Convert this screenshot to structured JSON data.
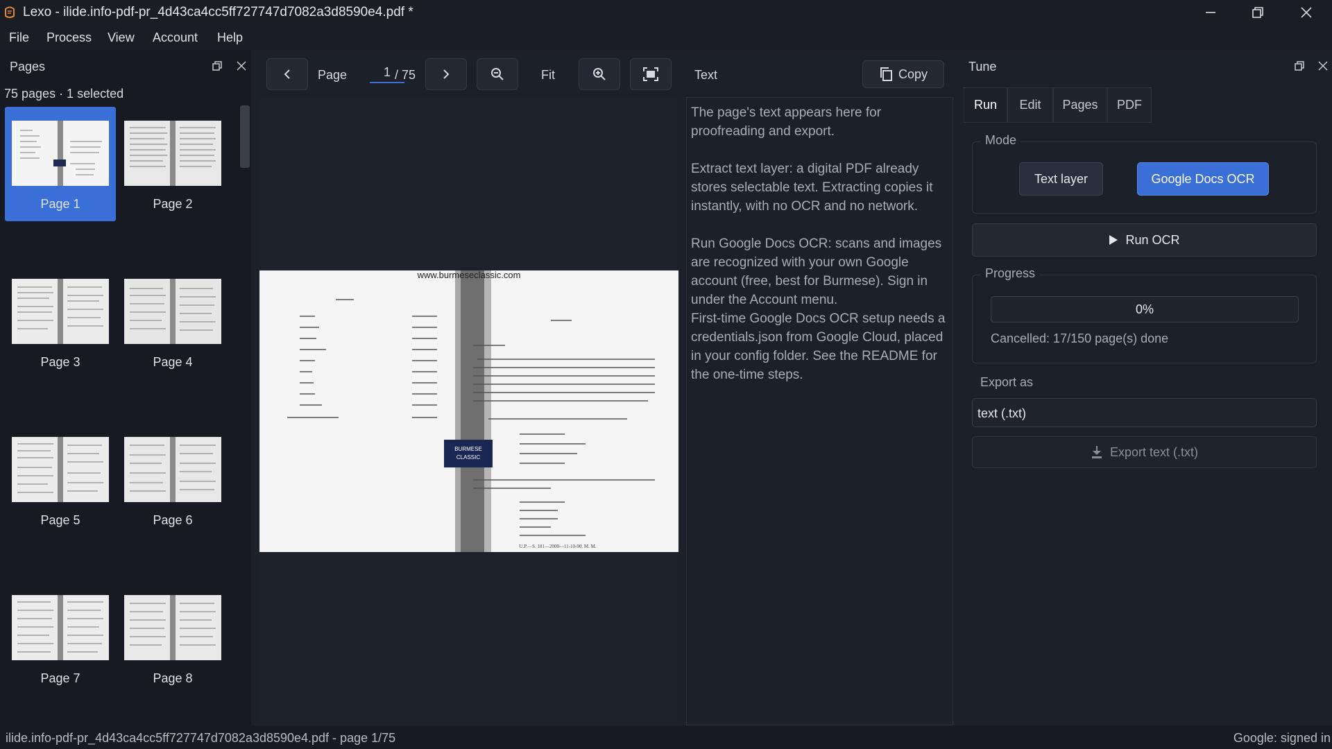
{
  "window": {
    "title": "Lexo - ilide.info-pdf-pr_4d43ca4cc5ff727747d7082a3d8590e4.pdf *"
  },
  "menu": [
    "File",
    "Process",
    "View",
    "Account",
    "Help"
  ],
  "pages_panel": {
    "title": "Pages",
    "summary": "75 pages · 1 selected",
    "thumbnails": [
      {
        "label": "Page 1"
      },
      {
        "label": "Page 2"
      },
      {
        "label": "Page 3"
      },
      {
        "label": "Page 4"
      },
      {
        "label": "Page 5"
      },
      {
        "label": "Page 6"
      },
      {
        "label": "Page 7"
      },
      {
        "label": "Page 8"
      }
    ]
  },
  "viewer": {
    "page_label": "Page",
    "current_page": "1",
    "total_pages": "/ 75",
    "fit_label": "Fit",
    "page_content": {
      "header_url": "www.burmeseclassic.com",
      "logo_text_1": "BURMESE",
      "logo_text_2": "CLASSIC",
      "footer_text": "U.P.—S. 181—2000—11-10-90.     M. M."
    }
  },
  "text_panel": {
    "title": "Text",
    "copy_label": "Copy",
    "paragraphs": [
      "The page's text appears here for proofreading and export.",
      "Extract text layer: a digital PDF already stores selectable text. Extracting copies it instantly, with no OCR and no network.",
      "Run Google Docs OCR: scans and images are recognized with your own Google account (free, best for Burmese). Sign in under the Account menu.",
      "First-time Google Docs OCR setup needs a credentials.json from Google Cloud, placed in your config folder. See the README for the one-time steps."
    ]
  },
  "tune_panel": {
    "title": "Tune",
    "tabs": [
      "Run",
      "Edit",
      "Pages",
      "PDF"
    ],
    "active_tab": "Run",
    "mode": {
      "label": "Mode",
      "text_layer": "Text layer",
      "google_ocr": "Google Docs OCR",
      "selected": "Google Docs OCR"
    },
    "run_label": "Run OCR",
    "progress": {
      "label": "Progress",
      "value_text": "0%",
      "value": 0,
      "status": "Cancelled: 17/150 page(s) done"
    },
    "export": {
      "label": "Export as",
      "format": "text (.txt)",
      "button": "Export text (.txt)"
    }
  },
  "status_bar": {
    "left": "ilide.info-pdf-pr_4d43ca4cc5ff727747d7082a3d8590e4.pdf - page 1/75",
    "right": "Google: signed in"
  },
  "colors": {
    "accent": "#3b6fd8",
    "background": "#1b1f27",
    "panel": "#1c2028"
  }
}
